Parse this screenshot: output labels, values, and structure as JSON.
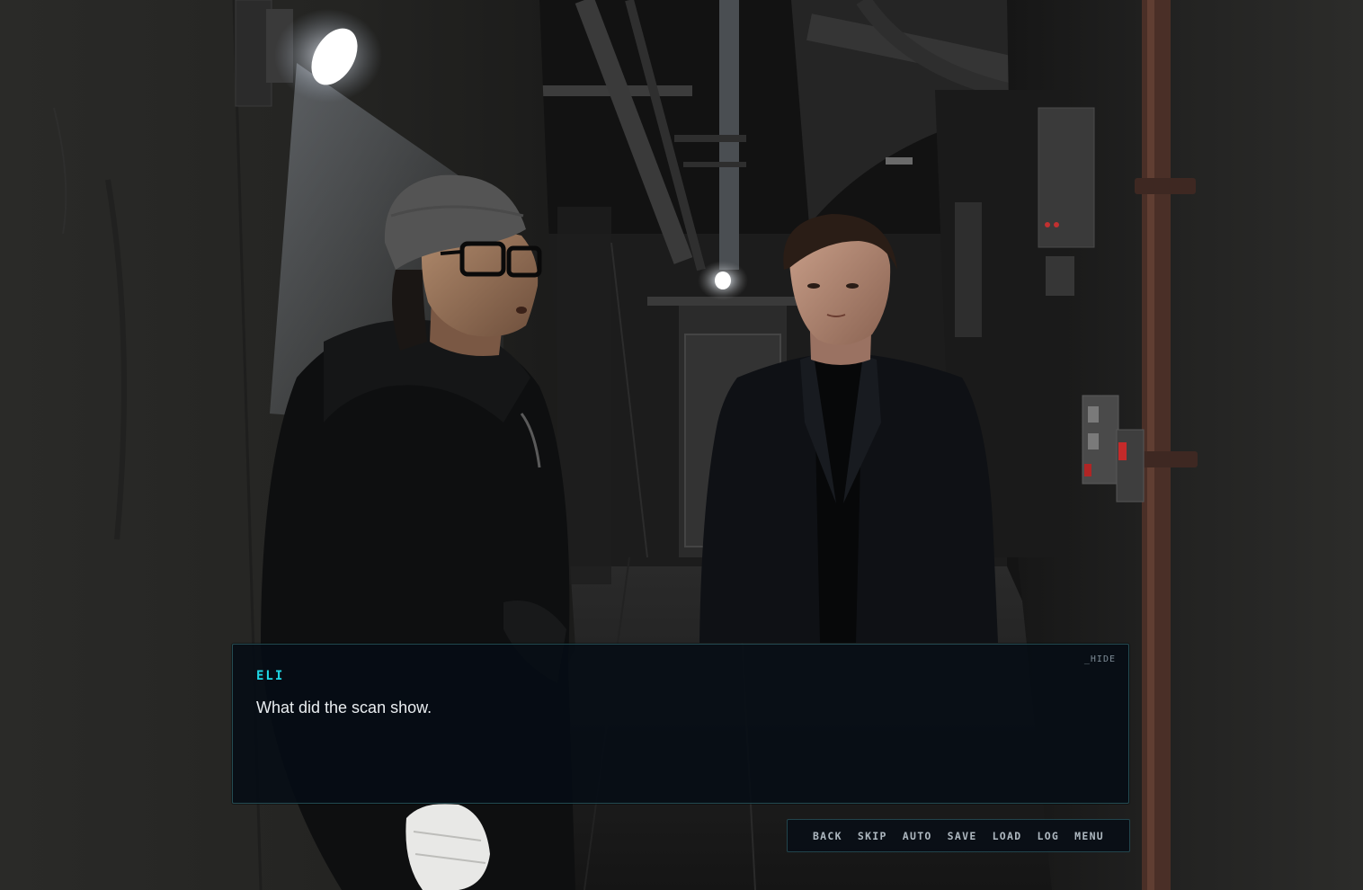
{
  "dialogue": {
    "speaker": "ELI",
    "text": "What did the scan show.",
    "hide_label": "_HIDE"
  },
  "quick_menu": {
    "back": "BACK",
    "skip": "SKIP",
    "auto": "AUTO",
    "save": "SAVE",
    "load": "LOAD",
    "log": "LOG",
    "menu": "MENU"
  },
  "scene": {
    "background": "dark-industrial-corridor",
    "characters": [
      "man-in-beanie-and-glasses",
      "man-in-dark-suit"
    ]
  },
  "colors": {
    "speaker_name": "#1ed8e6",
    "dialogue_text": "#e9edf0",
    "panel_border": "#46969f",
    "menu_text": "#aeb8c0"
  }
}
